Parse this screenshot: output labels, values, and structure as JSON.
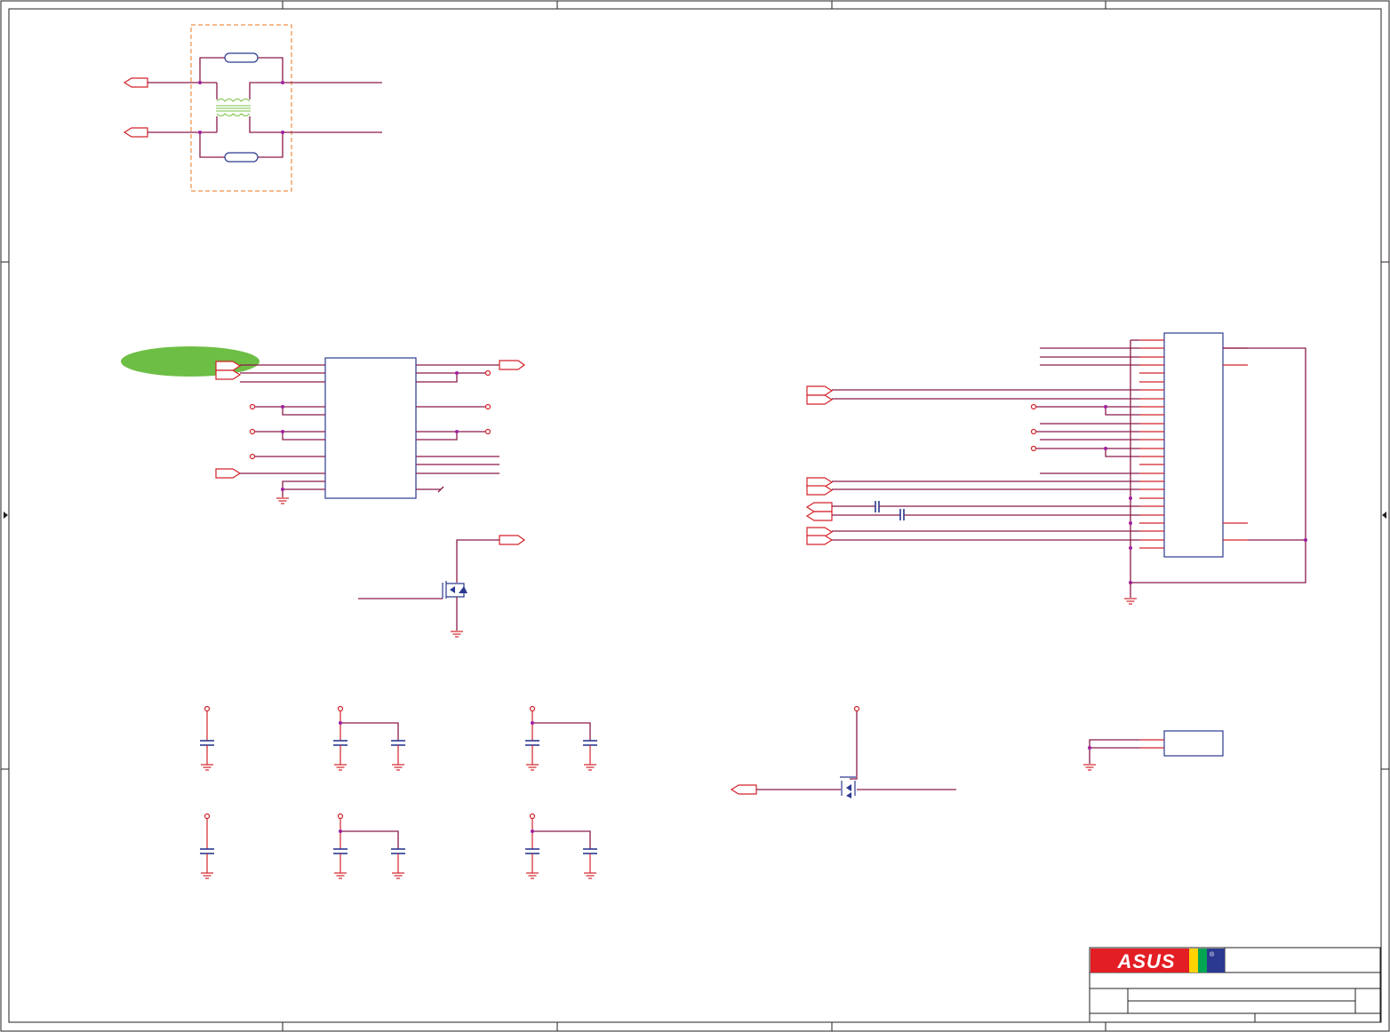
{
  "logo": {
    "text": "ASUS",
    "registered": "®",
    "colors": {
      "red": "#e31e24",
      "blue": "#2b3990",
      "stripe_red": "#e31e24",
      "stripe_yellow": "#ffd200",
      "stripe_green": "#00a651"
    }
  },
  "highlight": {
    "color": "#6dbe45",
    "label": ""
  },
  "colors": {
    "wire": "#8b1a4a",
    "component": "#d2232a",
    "body": "#2b3990",
    "frame": "#231f20",
    "transformer": "#7ac143",
    "boundary": "#e87722"
  }
}
